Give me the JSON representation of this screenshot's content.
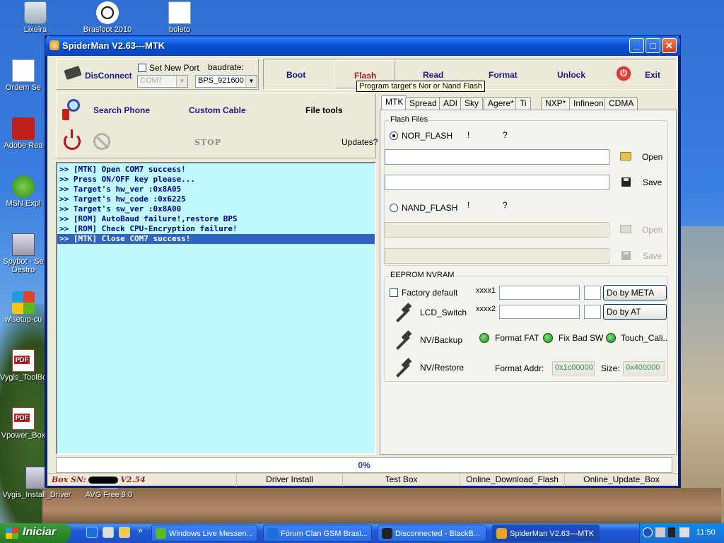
{
  "desktop": {
    "icons": [
      {
        "label": "Lixeira",
        "icon": "recycle-bin-icon"
      },
      {
        "label": "Brasfoot 2010",
        "icon": "soccer-ball-icon"
      },
      {
        "label": "boleto",
        "icon": "document-icon"
      },
      {
        "label": "Ordem Se",
        "icon": "document-icon"
      },
      {
        "label": "Adobe Rea",
        "icon": "adobe-reader-icon"
      },
      {
        "label": "MSN Expl",
        "icon": "msn-icon"
      },
      {
        "label": "Spybot - Se Destro",
        "icon": "spybot-icon"
      },
      {
        "label": "wlsetup-cu",
        "icon": "windows-live-icon"
      },
      {
        "label": "Vygis_ToolBo",
        "icon": "pdf-icon"
      },
      {
        "label": "Vpower_Box",
        "icon": "pdf-icon"
      },
      {
        "label": "Vygis_Install_Driver",
        "icon": "installer-icon"
      },
      {
        "label": "AVG Free 9.0",
        "icon": "avg-icon"
      }
    ]
  },
  "window": {
    "title": "SpiderMan V2.63---MTK",
    "controls": {
      "minimize": "_",
      "maximize": "□",
      "close": "✕"
    }
  },
  "connection": {
    "disconnect_label": "DisConnect",
    "set_new_port_label": "Set New Port",
    "set_new_port_checked": false,
    "baudrate_label": "baudrate:",
    "port_value": "COM7",
    "baudrate_value": "BPS_921600"
  },
  "actions": {
    "boot": "Boot",
    "flash": "Flash",
    "read": "Read",
    "format": "Format",
    "unlock": "Unlock",
    "exit": "Exit",
    "flash_tooltip": "Program target's Nor or Nand Flash"
  },
  "left_panel": {
    "search_phone": "Search Phone",
    "custom_cable": "Custom Cable",
    "file_tools": "File tools",
    "stop": "STOP",
    "updates": "Updates?"
  },
  "log": {
    "lines": [
      ">> [MTK] Open COM7 success!",
      ">> Press ON/OFF key please...",
      ">> Target's hw_ver :0x8A05",
      ">> Target's hw_code :0x6225",
      ">> Target's sw_ver :0x8A00",
      ">> [ROM] AutoBaud failure!,restore BPS",
      ">> [ROM] Check CPU-Encryption failure!",
      ">> [MTK] Close COM7 success!"
    ],
    "selected_index": 7
  },
  "tabs": [
    "MTK",
    "Spread",
    "ADI",
    "Sky",
    "Agere*",
    "Ti",
    "NXP*",
    "Infineon",
    "CDMA"
  ],
  "active_tab": "MTK",
  "flash_files": {
    "group_title": "Flash Files",
    "nor_label": "NOR_FLASH",
    "nor_selected": true,
    "nor_mark1": "!",
    "nor_mark2": "?",
    "nand_label": "NAND_FLASH",
    "nand_selected": false,
    "nand_mark1": "!",
    "nand_mark2": "?",
    "open_label": "Open",
    "save_label": "Save",
    "nor_path": "",
    "nor_save_path": "",
    "nand_path": "",
    "nand_save_path": ""
  },
  "eeprom": {
    "group_title": "EEPROM NVRAM",
    "factory_default_label": "Factory default",
    "factory_default_checked": false,
    "xxxx1_label": "xxxx1",
    "xxxx2_label": "xxxx2",
    "xxxx1_value": "",
    "xxxx2_value": "",
    "do_by_meta": "Do by META",
    "do_by_at": "Do by AT",
    "lcd_switch": "LCD_Switch",
    "nv_backup": "NV/Backup",
    "nv_restore": "NV/Restore",
    "format_fat": "Format FAT",
    "fix_bad_sw": "Fix Bad SW",
    "touch_cali": "Touch_Cali..",
    "format_addr_label": "Format Addr:",
    "format_addr_value": "0x1c00000",
    "size_label": "Size:",
    "size_value": "0x400000"
  },
  "progress": {
    "value_text": "0%",
    "value": 0
  },
  "statusbar": {
    "box_sn_label": "Box SN:",
    "box_version": "V2.54",
    "driver_install": "Driver Install",
    "test_box": "Test Box",
    "online_download_flash": "Online_Download_Flash",
    "online_update_box": "Online_Update_Box"
  },
  "taskbar": {
    "start_label": "Iniciar",
    "overflow": "»",
    "tasks": [
      {
        "label": "Windows Live Messen...",
        "icon": "messenger-icon"
      },
      {
        "label": "Fórum Clan GSM Brasi...",
        "icon": "internet-explorer-icon"
      },
      {
        "label": "Disconnected - BlackB...",
        "icon": "blackberry-icon"
      },
      {
        "label": "SpiderMan V2.63---MTK",
        "icon": "spiderman-icon"
      }
    ],
    "clock": "11:50"
  }
}
